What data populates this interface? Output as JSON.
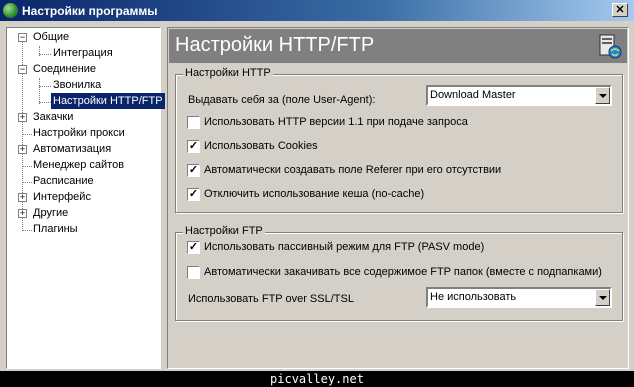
{
  "window": {
    "title": "Настройки программы"
  },
  "tree": {
    "items": [
      {
        "label": "Общие",
        "expander": "−"
      },
      {
        "label": "Интеграция"
      },
      {
        "label": "Соединение",
        "expander": "−"
      },
      {
        "label": "Звонилка"
      },
      {
        "label": "Настройки HTTP/FTP",
        "selected": true
      },
      {
        "label": "Закачки",
        "expander": "+"
      },
      {
        "label": "Настройки прокси"
      },
      {
        "label": "Автоматизация",
        "expander": "+"
      },
      {
        "label": "Менеджер сайтов"
      },
      {
        "label": "Расписание"
      },
      {
        "label": "Интерфейс",
        "expander": "+"
      },
      {
        "label": "Другие",
        "expander": "+"
      },
      {
        "label": "Плагины"
      }
    ]
  },
  "panel": {
    "title": "Настройки HTTP/FTP",
    "http": {
      "legend": "Настройки HTTP",
      "user_agent_label": "Выдавать себя за (поле User-Agent):",
      "user_agent_value": "Download Master",
      "checkboxes": [
        {
          "label": "Использовать HTTP версии 1.1 при подаче запроса",
          "checked": false,
          "mark": ""
        },
        {
          "label": "Использовать Cookies",
          "checked": true,
          "mark": "✓"
        },
        {
          "label": "Автоматически создавать поле Referer при его отсутствии",
          "checked": true,
          "mark": "✓"
        },
        {
          "label": "Отключить использование кеша (no-cache)",
          "checked": true,
          "mark": "✓"
        }
      ]
    },
    "ftp": {
      "legend": "Настройки FTP",
      "checkboxes": [
        {
          "label": "Использовать пассивный режим для FTP (PASV mode)",
          "checked": true,
          "mark": "✓"
        },
        {
          "label": "Автоматически закачивать все содержимое FTP папок (вместе с подпапками)",
          "checked": false,
          "mark": ""
        }
      ],
      "ssl_label": "Использовать FTP over SSL/TSL",
      "ssl_value": "Не использовать"
    }
  },
  "watermark": "picvalley.net"
}
